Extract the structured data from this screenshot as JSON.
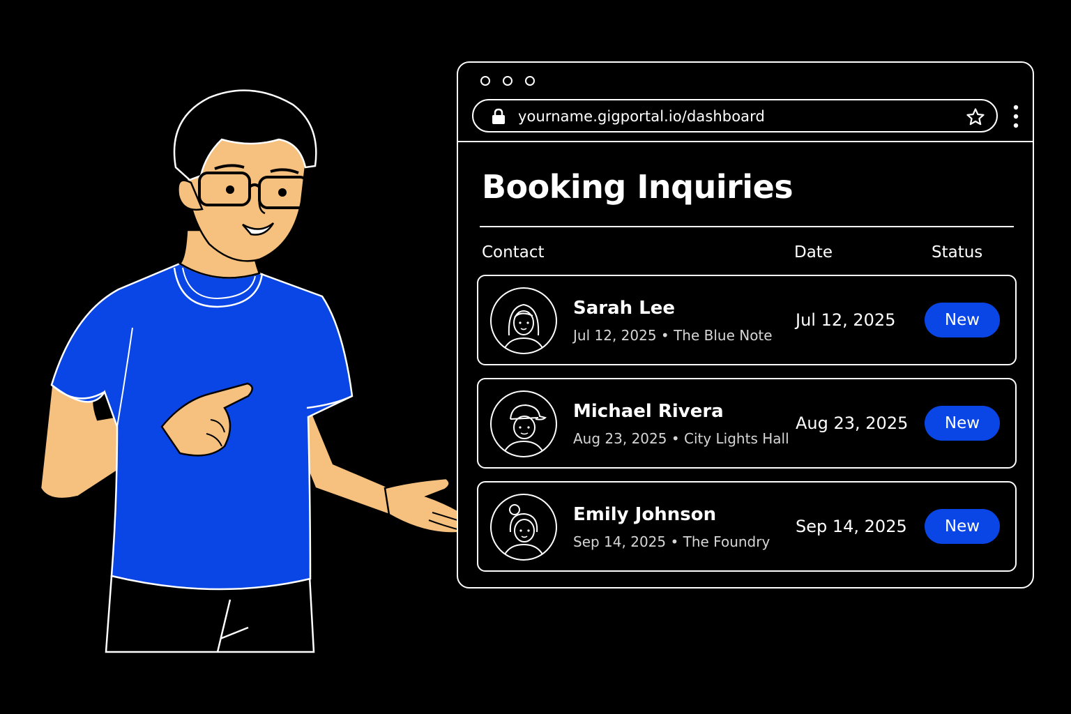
{
  "browser": {
    "url": "yourname.gigportal.io/dashboard",
    "icons": [
      "lock-icon",
      "star-icon",
      "more-vertical-icon"
    ]
  },
  "page": {
    "title": "Booking Inquiries",
    "columns": {
      "contact": "Contact",
      "date": "Date",
      "status": "Status"
    }
  },
  "inquiries": [
    {
      "name": "Sarah Lee",
      "subtitle": "Jul 12, 2025 • The Blue Note",
      "date": "Jul 12, 2025",
      "status": "New"
    },
    {
      "name": "Michael Rivera",
      "subtitle": "Aug 23, 2025 • City Lights Hall",
      "date": "Aug 23, 2025",
      "status": "New"
    },
    {
      "name": "Emily Johnson",
      "subtitle": "Sep 14, 2025 • The Foundry",
      "date": "Sep 14, 2025",
      "status": "New"
    }
  ],
  "colors": {
    "background": "#000000",
    "accent": "#0a46e6",
    "shirt": "#0a46e6",
    "skin": "#f6c07e",
    "line": "#ffffff"
  }
}
